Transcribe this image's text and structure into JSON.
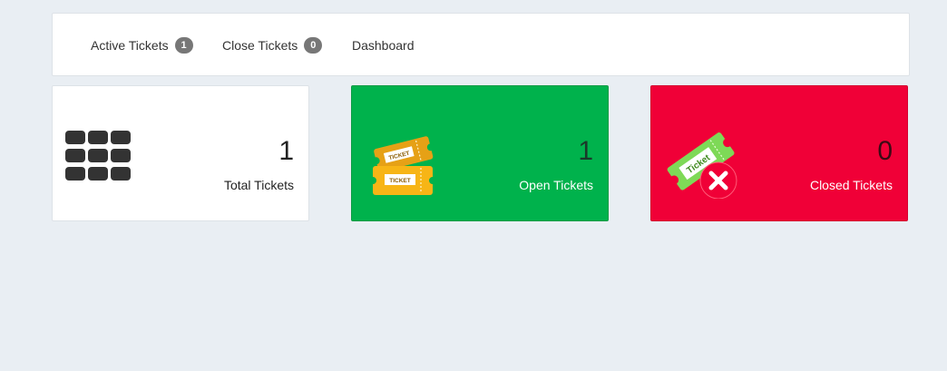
{
  "nav": {
    "items": [
      {
        "label": "Active Tickets",
        "badge": "1"
      },
      {
        "label": "Close Tickets",
        "badge": "0"
      },
      {
        "label": "Dashboard"
      }
    ]
  },
  "cards": {
    "total": {
      "count": "1",
      "label": "Total Tickets",
      "icon": "grid-icon"
    },
    "open": {
      "count": "1",
      "label": "Open Tickets",
      "icon": "tickets-icon",
      "ticket_text": "TICKET"
    },
    "closed": {
      "count": "0",
      "label": "Closed Tickets",
      "icon": "ticket-closed-icon",
      "ticket_text": "Ticket"
    }
  },
  "colors": {
    "background": "#e9eef3",
    "open_card": "#00b24c",
    "closed_card": "#f00037",
    "badge": "#777777"
  }
}
